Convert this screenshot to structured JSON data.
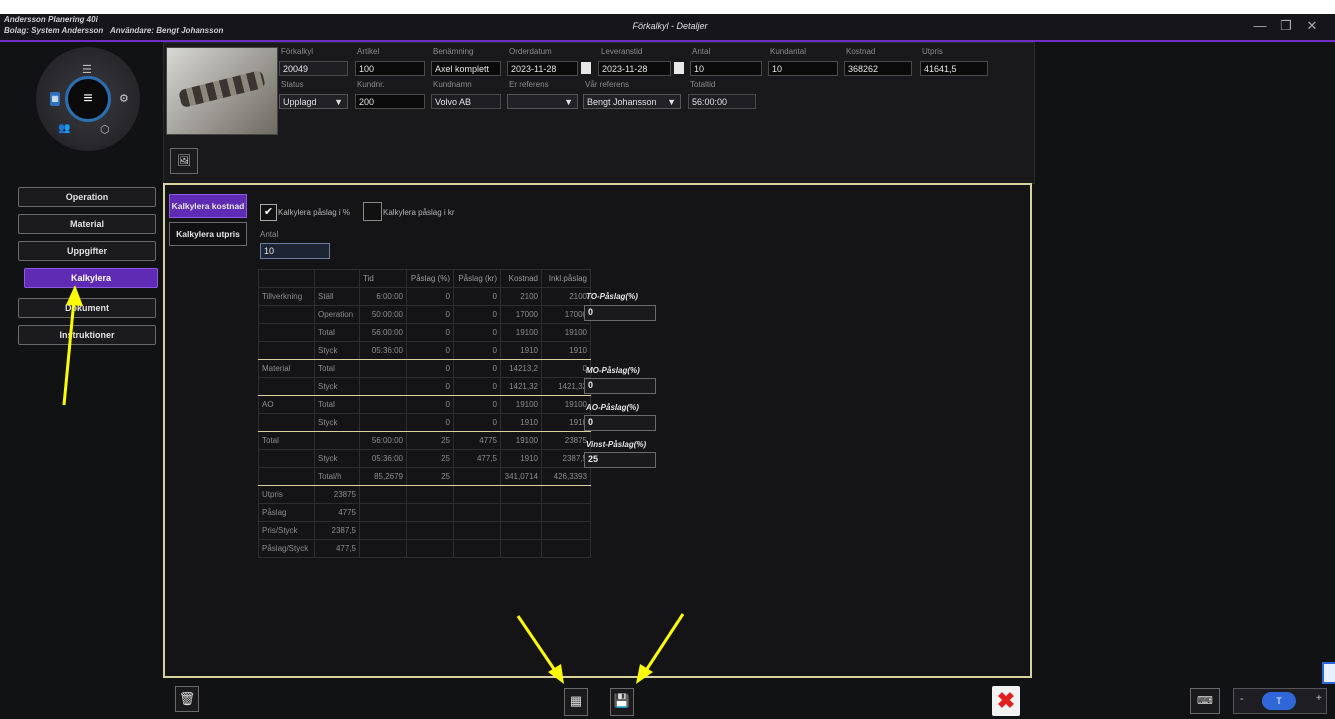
{
  "window": {
    "app_name": "Andersson Planering 40i",
    "company_label": "Bolag:",
    "company": "System Andersson",
    "user_label": "Användare:",
    "user": "Bengt Johansson",
    "title": "Förkalkyl - Detaljer"
  },
  "header": {
    "forkalkyl": {
      "label": "Förkalkyl",
      "value": "20049"
    },
    "artikel": {
      "label": "Artikel",
      "value": "100"
    },
    "benamning": {
      "label": "Benämning",
      "value": "Axel komplett"
    },
    "orderdatum": {
      "label": "Orderdatum",
      "value": "2023-11-28"
    },
    "leveranstid": {
      "label": "Leveranstid",
      "value": "2023-11-28"
    },
    "antal": {
      "label": "Antal",
      "value": "10"
    },
    "kundantal": {
      "label": "Kundantal",
      "value": "10"
    },
    "kostnad": {
      "label": "Kostnad",
      "value": "368262"
    },
    "utpris": {
      "label": "Utpris",
      "value": "41641,5"
    },
    "status": {
      "label": "Status",
      "value": "Upplagd"
    },
    "kundnr": {
      "label": "Kundnr.",
      "value": "200"
    },
    "kundnamn": {
      "label": "Kundnamn",
      "value": "Volvo AB"
    },
    "er_referens": {
      "label": "Er referens",
      "value": ""
    },
    "var_referens": {
      "label": "Vår referens",
      "value": "Bengt Johansson"
    },
    "totaltid": {
      "label": "Totaltid",
      "value": "56:00:00"
    }
  },
  "nav": {
    "items": [
      "Operation",
      "Material",
      "Uppgifter",
      "Kalkylera",
      "Dokument",
      "Instruktioner"
    ],
    "active": "Kalkylera"
  },
  "tabs": {
    "kostnad": "Kalkylera kostnad",
    "utpris": "Kalkylera utpris",
    "active": "Kalkylera kostnad"
  },
  "options": {
    "pct_label": "Kalkylera påslag i %",
    "pct_checked": true,
    "kr_label": "Kalkylera påslag i kr",
    "kr_checked": false,
    "antal_label": "Antal",
    "antal_value": "10"
  },
  "table": {
    "headers": [
      "",
      "",
      "Tid",
      "Påslag (%)",
      "Påslag (kr)",
      "Kostnad",
      "Inkl.påslag"
    ],
    "rows": [
      [
        "Tillverkning",
        "Ställ",
        "6:00:00",
        "0",
        "0",
        "2100",
        "2100"
      ],
      [
        "",
        "Operation",
        "50:00:00",
        "0",
        "0",
        "17000",
        "17000"
      ],
      [
        "",
        "Total",
        "56:00:00",
        "0",
        "0",
        "19100",
        "19100"
      ],
      [
        "",
        "Styck",
        "05:36:00",
        "0",
        "0",
        "1910",
        "1910"
      ],
      [
        "Material",
        "Total",
        "",
        "0",
        "0",
        "14213,2",
        "0"
      ],
      [
        "",
        "Styck",
        "",
        "0",
        "0",
        "1421,32",
        "1421,32"
      ],
      [
        "AO",
        "Total",
        "",
        "0",
        "0",
        "19100",
        "19100"
      ],
      [
        "",
        "Styck",
        "",
        "0",
        "0",
        "1910",
        "1910"
      ],
      [
        "Total",
        "",
        "56:00:00",
        "25",
        "4775",
        "19100",
        "23875"
      ],
      [
        "",
        "Styck",
        "05:36:00",
        "25",
        "477,5",
        "1910",
        "2387,5"
      ],
      [
        "",
        "Total/h",
        "85,2679",
        "25",
        "",
        "341,0714",
        "426,3393"
      ]
    ],
    "summary": [
      [
        "Utpris",
        "23875"
      ],
      [
        "Påslag",
        "4775"
      ],
      [
        "Pris/Styck",
        "2387,5"
      ],
      [
        "Påslag/Styck",
        "477,5"
      ]
    ]
  },
  "side_fields": {
    "to": {
      "label": "TO-Påslag(%)",
      "value": "0"
    },
    "mo": {
      "label": "MO-Påslag(%)",
      "value": "0"
    },
    "ao": {
      "label": "AO-Påslag(%)",
      "value": "0"
    },
    "vinst": {
      "label": "Vinst-Påslag(%)",
      "value": "25"
    }
  },
  "colors": {
    "accent": "#5f2bb5",
    "panel_border": "#d8d2a0",
    "annotation_arrow": "#ffff00",
    "delete_red": "#e02020"
  },
  "icons": [
    "calculator-icon",
    "save-icon",
    "trash-icon",
    "close-icon",
    "keyboard-icon",
    "image-icon"
  ]
}
